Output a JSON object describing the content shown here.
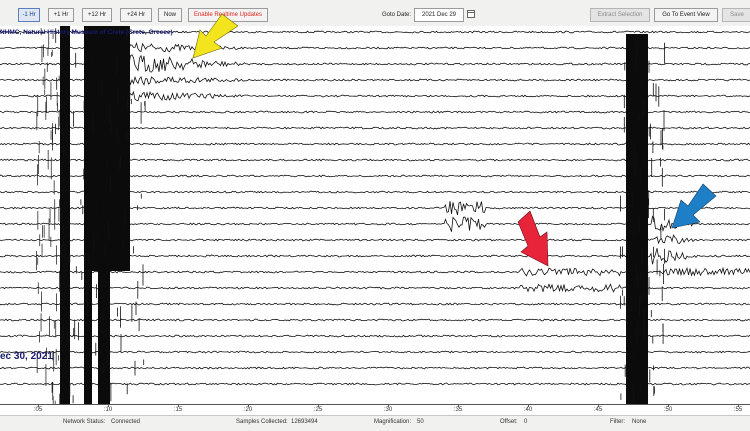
{
  "toolbar": {
    "buttons": [
      {
        "label": "-1 Hr",
        "active": true
      },
      {
        "label": "+1 Hr",
        "active": false
      },
      {
        "label": "+12 Hr",
        "active": false
      },
      {
        "label": "+24 Hr",
        "active": false
      },
      {
        "label": "Now",
        "active": false
      }
    ],
    "realtime_label": "Enable Realtime Updates",
    "goto_label": "Goto Date:",
    "goto_value": "2021 Dec 29",
    "extract_label": "Extract Selection",
    "event_view_label": "Go To Event View",
    "save_label": "Save"
  },
  "plot": {
    "station": "NHMC, Natural History Museum of Crete (Crete, Greece)",
    "date_marker": "ec 30, 2021",
    "axis_ticks": [
      ":05",
      ":10",
      ":15",
      ":20",
      ":25",
      ":30",
      ":35",
      ":40",
      ":45",
      ":50",
      ":55"
    ]
  },
  "arrows": [
    {
      "name": "yellow-arrow",
      "color": "#f2e51d"
    },
    {
      "name": "red-arrow",
      "color": "#e8243a"
    },
    {
      "name": "blue-arrow",
      "color": "#1f7fc6"
    }
  ],
  "status": {
    "network_label": "Network Status:",
    "network_value": "Connected",
    "samples_label": "Samples Collected:",
    "samples_value": "12693494",
    "magnification_label": "Magnification:",
    "magnification_value": "50",
    "offset_label": "Offset:",
    "offset_value": "0",
    "filter_label": "Filter:",
    "filter_value": "None"
  }
}
